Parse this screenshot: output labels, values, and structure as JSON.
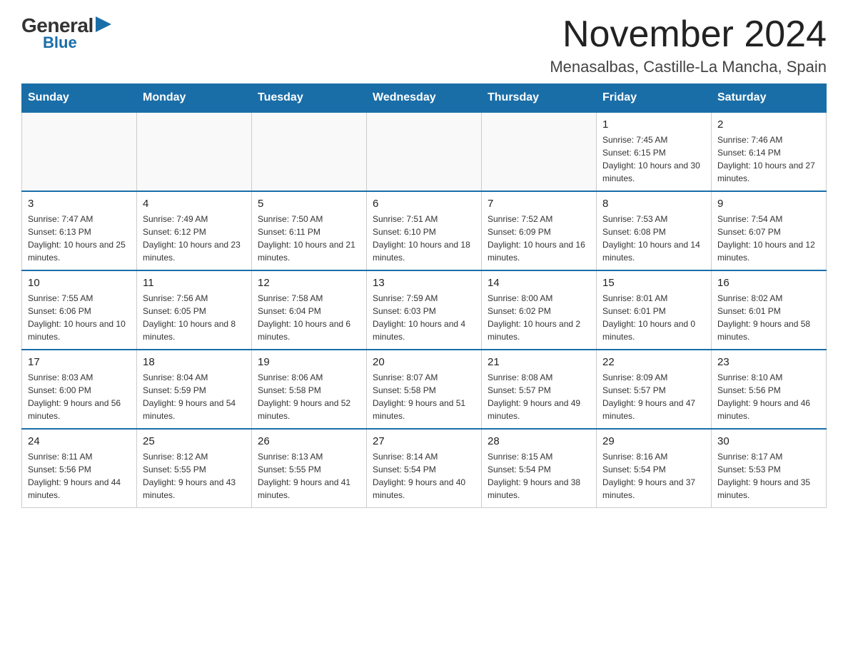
{
  "logo": {
    "general": "General",
    "triangle": "▶",
    "blue": "Blue"
  },
  "title": "November 2024",
  "subtitle": "Menasalbas, Castille-La Mancha, Spain",
  "weekdays": [
    "Sunday",
    "Monday",
    "Tuesday",
    "Wednesday",
    "Thursday",
    "Friday",
    "Saturday"
  ],
  "weeks": [
    [
      {
        "day": "",
        "sunrise": "",
        "sunset": "",
        "daylight": ""
      },
      {
        "day": "",
        "sunrise": "",
        "sunset": "",
        "daylight": ""
      },
      {
        "day": "",
        "sunrise": "",
        "sunset": "",
        "daylight": ""
      },
      {
        "day": "",
        "sunrise": "",
        "sunset": "",
        "daylight": ""
      },
      {
        "day": "",
        "sunrise": "",
        "sunset": "",
        "daylight": ""
      },
      {
        "day": "1",
        "sunrise": "Sunrise: 7:45 AM",
        "sunset": "Sunset: 6:15 PM",
        "daylight": "Daylight: 10 hours and 30 minutes."
      },
      {
        "day": "2",
        "sunrise": "Sunrise: 7:46 AM",
        "sunset": "Sunset: 6:14 PM",
        "daylight": "Daylight: 10 hours and 27 minutes."
      }
    ],
    [
      {
        "day": "3",
        "sunrise": "Sunrise: 7:47 AM",
        "sunset": "Sunset: 6:13 PM",
        "daylight": "Daylight: 10 hours and 25 minutes."
      },
      {
        "day": "4",
        "sunrise": "Sunrise: 7:49 AM",
        "sunset": "Sunset: 6:12 PM",
        "daylight": "Daylight: 10 hours and 23 minutes."
      },
      {
        "day": "5",
        "sunrise": "Sunrise: 7:50 AM",
        "sunset": "Sunset: 6:11 PM",
        "daylight": "Daylight: 10 hours and 21 minutes."
      },
      {
        "day": "6",
        "sunrise": "Sunrise: 7:51 AM",
        "sunset": "Sunset: 6:10 PM",
        "daylight": "Daylight: 10 hours and 18 minutes."
      },
      {
        "day": "7",
        "sunrise": "Sunrise: 7:52 AM",
        "sunset": "Sunset: 6:09 PM",
        "daylight": "Daylight: 10 hours and 16 minutes."
      },
      {
        "day": "8",
        "sunrise": "Sunrise: 7:53 AM",
        "sunset": "Sunset: 6:08 PM",
        "daylight": "Daylight: 10 hours and 14 minutes."
      },
      {
        "day": "9",
        "sunrise": "Sunrise: 7:54 AM",
        "sunset": "Sunset: 6:07 PM",
        "daylight": "Daylight: 10 hours and 12 minutes."
      }
    ],
    [
      {
        "day": "10",
        "sunrise": "Sunrise: 7:55 AM",
        "sunset": "Sunset: 6:06 PM",
        "daylight": "Daylight: 10 hours and 10 minutes."
      },
      {
        "day": "11",
        "sunrise": "Sunrise: 7:56 AM",
        "sunset": "Sunset: 6:05 PM",
        "daylight": "Daylight: 10 hours and 8 minutes."
      },
      {
        "day": "12",
        "sunrise": "Sunrise: 7:58 AM",
        "sunset": "Sunset: 6:04 PM",
        "daylight": "Daylight: 10 hours and 6 minutes."
      },
      {
        "day": "13",
        "sunrise": "Sunrise: 7:59 AM",
        "sunset": "Sunset: 6:03 PM",
        "daylight": "Daylight: 10 hours and 4 minutes."
      },
      {
        "day": "14",
        "sunrise": "Sunrise: 8:00 AM",
        "sunset": "Sunset: 6:02 PM",
        "daylight": "Daylight: 10 hours and 2 minutes."
      },
      {
        "day": "15",
        "sunrise": "Sunrise: 8:01 AM",
        "sunset": "Sunset: 6:01 PM",
        "daylight": "Daylight: 10 hours and 0 minutes."
      },
      {
        "day": "16",
        "sunrise": "Sunrise: 8:02 AM",
        "sunset": "Sunset: 6:01 PM",
        "daylight": "Daylight: 9 hours and 58 minutes."
      }
    ],
    [
      {
        "day": "17",
        "sunrise": "Sunrise: 8:03 AM",
        "sunset": "Sunset: 6:00 PM",
        "daylight": "Daylight: 9 hours and 56 minutes."
      },
      {
        "day": "18",
        "sunrise": "Sunrise: 8:04 AM",
        "sunset": "Sunset: 5:59 PM",
        "daylight": "Daylight: 9 hours and 54 minutes."
      },
      {
        "day": "19",
        "sunrise": "Sunrise: 8:06 AM",
        "sunset": "Sunset: 5:58 PM",
        "daylight": "Daylight: 9 hours and 52 minutes."
      },
      {
        "day": "20",
        "sunrise": "Sunrise: 8:07 AM",
        "sunset": "Sunset: 5:58 PM",
        "daylight": "Daylight: 9 hours and 51 minutes."
      },
      {
        "day": "21",
        "sunrise": "Sunrise: 8:08 AM",
        "sunset": "Sunset: 5:57 PM",
        "daylight": "Daylight: 9 hours and 49 minutes."
      },
      {
        "day": "22",
        "sunrise": "Sunrise: 8:09 AM",
        "sunset": "Sunset: 5:57 PM",
        "daylight": "Daylight: 9 hours and 47 minutes."
      },
      {
        "day": "23",
        "sunrise": "Sunrise: 8:10 AM",
        "sunset": "Sunset: 5:56 PM",
        "daylight": "Daylight: 9 hours and 46 minutes."
      }
    ],
    [
      {
        "day": "24",
        "sunrise": "Sunrise: 8:11 AM",
        "sunset": "Sunset: 5:56 PM",
        "daylight": "Daylight: 9 hours and 44 minutes."
      },
      {
        "day": "25",
        "sunrise": "Sunrise: 8:12 AM",
        "sunset": "Sunset: 5:55 PM",
        "daylight": "Daylight: 9 hours and 43 minutes."
      },
      {
        "day": "26",
        "sunrise": "Sunrise: 8:13 AM",
        "sunset": "Sunset: 5:55 PM",
        "daylight": "Daylight: 9 hours and 41 minutes."
      },
      {
        "day": "27",
        "sunrise": "Sunrise: 8:14 AM",
        "sunset": "Sunset: 5:54 PM",
        "daylight": "Daylight: 9 hours and 40 minutes."
      },
      {
        "day": "28",
        "sunrise": "Sunrise: 8:15 AM",
        "sunset": "Sunset: 5:54 PM",
        "daylight": "Daylight: 9 hours and 38 minutes."
      },
      {
        "day": "29",
        "sunrise": "Sunrise: 8:16 AM",
        "sunset": "Sunset: 5:54 PM",
        "daylight": "Daylight: 9 hours and 37 minutes."
      },
      {
        "day": "30",
        "sunrise": "Sunrise: 8:17 AM",
        "sunset": "Sunset: 5:53 PM",
        "daylight": "Daylight: 9 hours and 35 minutes."
      }
    ]
  ]
}
